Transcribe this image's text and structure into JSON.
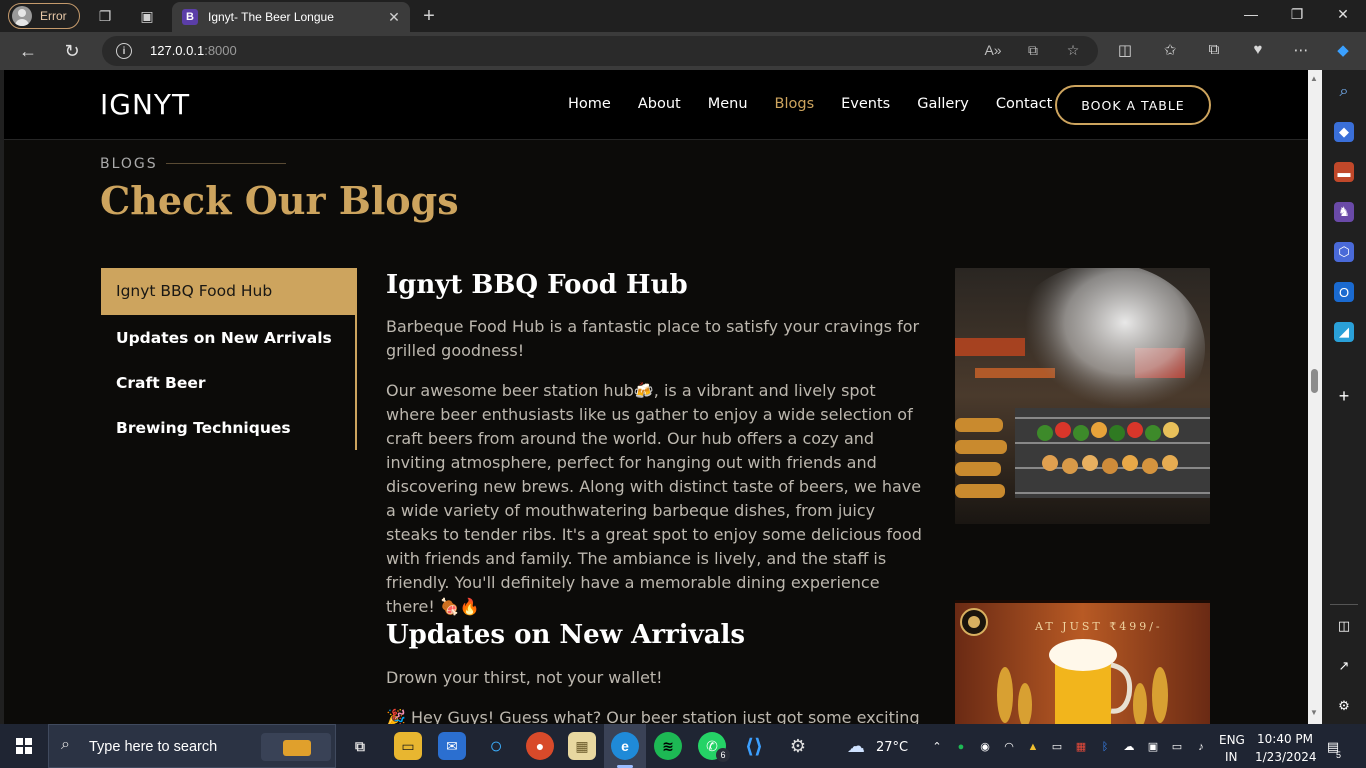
{
  "browser": {
    "profile_label": "Error",
    "tab_title": "Ignyt- The Beer Longue",
    "tab_favicon": "B",
    "url_host": "127.0.0.1",
    "url_port": ":8000"
  },
  "site": {
    "logo": "IGNYT",
    "nav": [
      "Home",
      "About",
      "Menu",
      "Blogs",
      "Events",
      "Gallery",
      "Contact"
    ],
    "active_nav": "Blogs",
    "book_button": "BOOK A TABLE",
    "accent_color": "#cda45e"
  },
  "section": {
    "label": "BLOGS",
    "title": "Check Our Blogs"
  },
  "blog_nav": [
    "Ignyt BBQ Food Hub",
    "Updates on New Arrivals",
    "Craft Beer",
    "Brewing Techniques"
  ],
  "posts": [
    {
      "title": "Ignyt BBQ Food Hub",
      "intro": "Barbeque Food Hub is a fantastic place to satisfy your cravings for grilled goodness!",
      "body": "Our awesome beer station hub🍻, is a vibrant and lively spot where beer enthusiasts like us gather to enjoy a wide selection of craft beers from around the world. Our hub offers a cozy and inviting atmosphere, perfect for hanging out with friends and discovering new brews. Along with distinct taste of beers, we have a wide variety of mouthwatering barbeque dishes, from juicy steaks to tender ribs. It's a great spot to enjoy some delicious food with friends and family. The ambiance is lively, and the staff is friendly. You'll definitely have a memorable dining experience there! 🍖🔥"
    },
    {
      "title": "Updates on New Arrivals",
      "intro": "Drown your thirst, not your wallet!",
      "body": "🎉 Hey Guys! Guess what? Our beer station just got some exciting new arrivals! 🍻 We've got a fresh batch of craft beers from around the"
    }
  ],
  "images": {
    "post1": "bbq-grill-photo",
    "post2": "beer-offer-poster",
    "poster_text": "AT JUST ₹499/-"
  },
  "taskbar": {
    "search_placeholder": "Type here to search",
    "weather": "27°C",
    "lang_line1": "ENG",
    "lang_line2": "IN",
    "time": "10:40 PM",
    "date": "1/23/2024",
    "whatsapp_badge": "6",
    "notif_count": "5"
  }
}
